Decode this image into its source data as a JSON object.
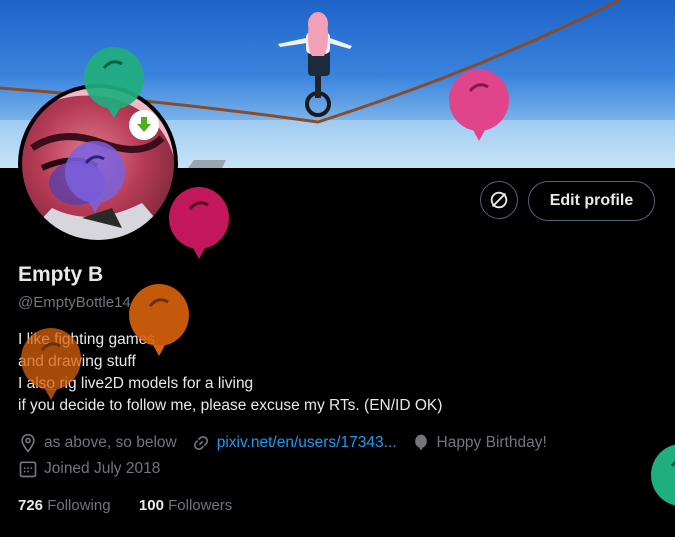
{
  "profile": {
    "name": "Empty B",
    "handle": "@EmptyBottle14",
    "bio_lines": [
      "I like fighting games",
      "and drawing stuff",
      "I also rig live2D models for a living",
      "if you decide to follow me, please excuse my RTs. (EN/ID OK)"
    ],
    "location": "as above, so below",
    "website": "pixiv.net/en/users/17343...",
    "birthday": "Happy Birthday!",
    "joined": "Joined July 2018",
    "following_count": "726",
    "following_label": "Following",
    "followers_count": "100",
    "followers_label": "Followers"
  },
  "actions": {
    "edit_profile_label": "Edit profile",
    "icon_button": "theme-icon"
  },
  "colors": {
    "link": "#1d9bf0",
    "muted": "#71767b",
    "text": "#e7e9ea",
    "balloon_green": "#1fae7d",
    "balloon_pink": "#e0458c",
    "balloon_magenta": "#c2185b",
    "balloon_orange": "#d9620c",
    "balloon_purple": "#7a62e0"
  }
}
